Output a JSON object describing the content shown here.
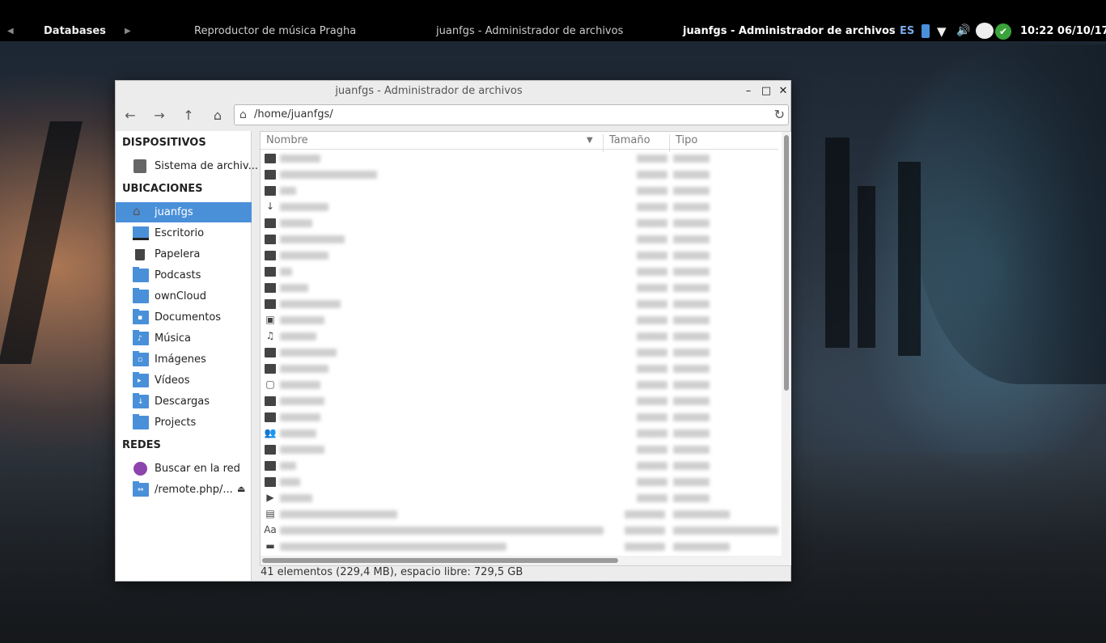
{
  "panel": {
    "databases": "Databases",
    "task1": "Reproductor de música Pragha",
    "task2": "juanfgs - Administrador de archivos",
    "task3": "juanfgs - Administrador de archivos",
    "lang": "ES",
    "clock": "10:22 06/10/17"
  },
  "window": {
    "title": "juanfgs - Administrador de archivos",
    "minimize": "–",
    "maximize": "□",
    "close": "✕"
  },
  "toolbar": {
    "back": "←",
    "forward": "→",
    "up": "↑",
    "home": "⌂",
    "path": "/home/juanfgs/",
    "reload": "↻"
  },
  "sidebar": {
    "devices_heading": "DISPOSITIVOS",
    "places_heading": "UBICACIONES",
    "network_heading": "REDES",
    "devices": [
      {
        "label": "Sistema de archiv..."
      }
    ],
    "places": [
      {
        "label": "juanfgs"
      },
      {
        "label": "Escritorio"
      },
      {
        "label": "Papelera"
      },
      {
        "label": "Podcasts"
      },
      {
        "label": "ownCloud"
      },
      {
        "label": "Documentos"
      },
      {
        "label": "Música"
      },
      {
        "label": "Imágenes"
      },
      {
        "label": "Vídeos"
      },
      {
        "label": "Descargas"
      },
      {
        "label": "Projects"
      }
    ],
    "network": [
      {
        "label": "Buscar en la red"
      },
      {
        "label": "/remote.php/..."
      }
    ]
  },
  "columns": {
    "name": "Nombre",
    "size": "Tamaño",
    "type": "Tipo"
  },
  "status": "41 elementos (229,4 MB), espacio libre: 729,5 GB"
}
